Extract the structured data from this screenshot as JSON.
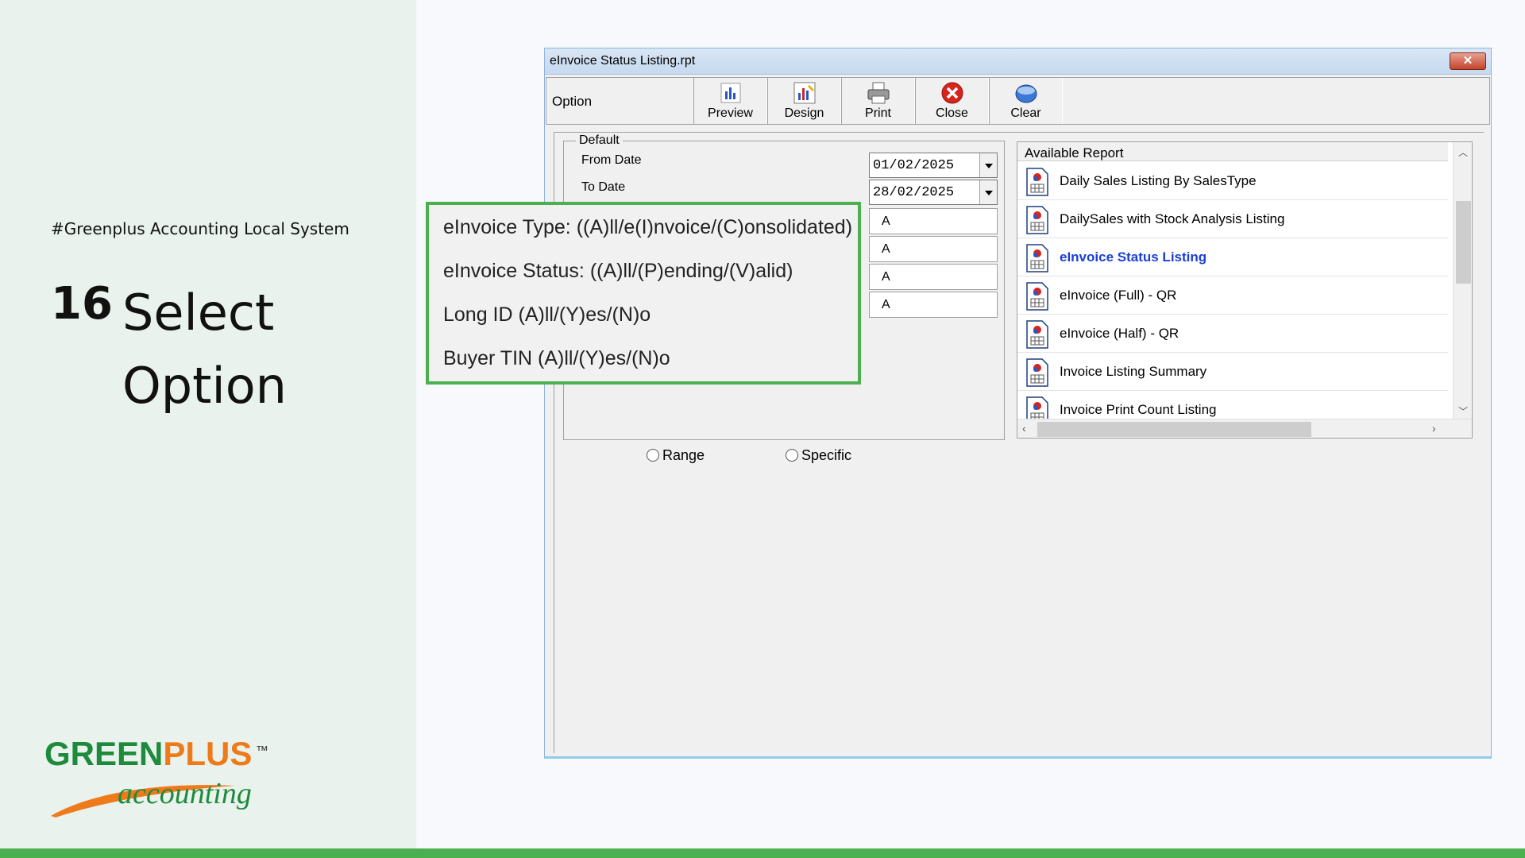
{
  "slide": {
    "tagline": "#Greenplus Accounting Local System",
    "step_number": "16",
    "step_title": "Select Option",
    "logo": {
      "brand_green": "GREEN",
      "brand_orange": "PLUS",
      "trademark": "™",
      "script": "accounting"
    },
    "colors": {
      "accent_green": "#4caf50",
      "logo_green": "#1e8a3c",
      "logo_orange": "#ef7a1a"
    }
  },
  "window": {
    "title": "eInvoice Status Listing.rpt",
    "close_label": "✕"
  },
  "toolbar": {
    "label": "Option",
    "buttons": [
      {
        "label": "Preview",
        "icon": "preview-chart-icon"
      },
      {
        "label": "Design",
        "icon": "design-chart-icon"
      },
      {
        "label": "Print",
        "icon": "printer-icon"
      },
      {
        "label": "Close",
        "icon": "close-red-icon"
      },
      {
        "label": "Clear",
        "icon": "clear-globe-icon"
      }
    ]
  },
  "default_group": {
    "legend": "Default",
    "from_date_label": "From Date",
    "from_date": "01/02/2025",
    "to_date_label": "To Date",
    "to_date": "28/02/2025",
    "option_values": [
      "A",
      "A",
      "A",
      "A"
    ]
  },
  "callout": {
    "lines": [
      "eInvoice Type: ((A)ll/e(I)nvoice/(C)onsolidated)",
      "eInvoice Status: ((A)ll/(P)ending/(V)alid)",
      "Long ID (A)ll/(Y)es/(N)o",
      "Buyer TIN (A)ll/(Y)es/(N)o"
    ]
  },
  "radios": {
    "range": "Range",
    "specific": "Specific"
  },
  "available_report": {
    "header": "Available Report",
    "items": [
      {
        "label": "Daily Sales Listing By SalesType",
        "selected": false
      },
      {
        "label": "DailySales with Stock Analysis Listing",
        "selected": false
      },
      {
        "label": "eInvoice Status Listing",
        "selected": true
      },
      {
        "label": "eInvoice (Full) - QR",
        "selected": false
      },
      {
        "label": "eInvoice (Half) - QR",
        "selected": false
      },
      {
        "label": "Invoice Listing Summary",
        "selected": false
      },
      {
        "label": "Invoice Print Count Listing",
        "selected": false
      }
    ]
  }
}
